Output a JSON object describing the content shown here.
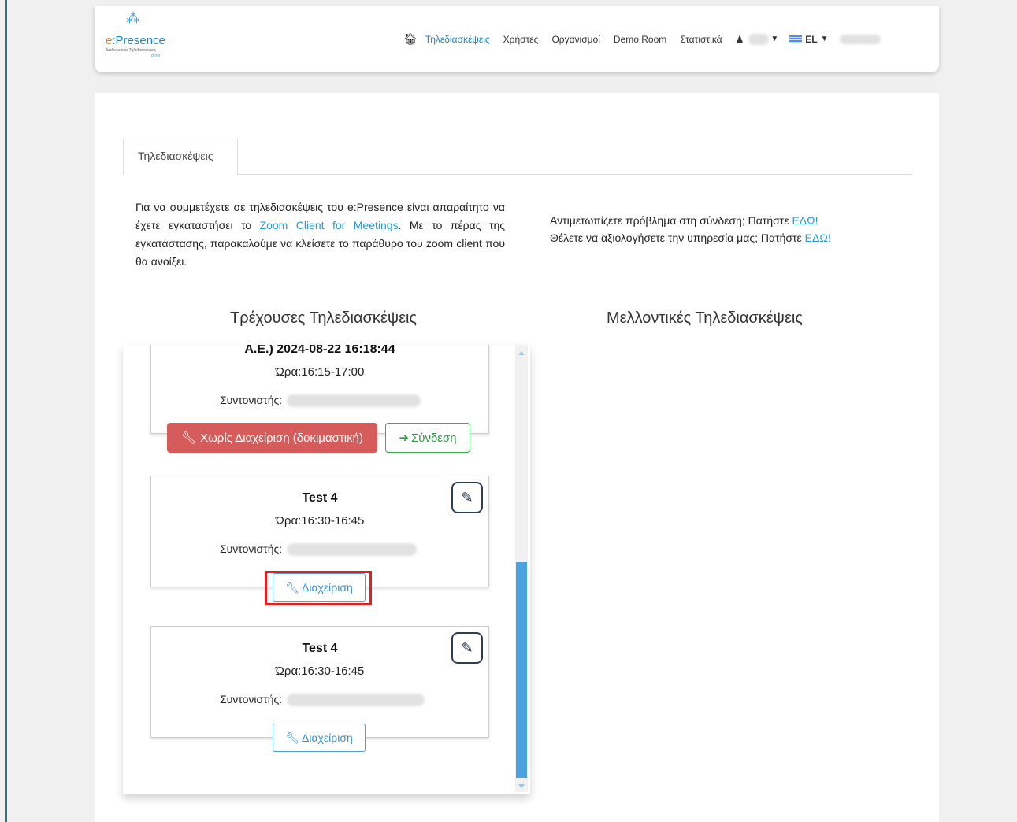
{
  "logo": {
    "dots": "⁂",
    "brand_e": "e",
    "brand_rest": ":Presence",
    "tagline": "Διαδικτυακές Τηλεδιασκέψεις",
    "tagline2": "grnet"
  },
  "nav": {
    "items": [
      {
        "label": "Τηλεδιασκέψεις",
        "active": true
      },
      {
        "label": "Χρήστες",
        "active": false
      },
      {
        "label": "Οργανισμοί",
        "active": false
      },
      {
        "label": "Demo Room",
        "active": false
      },
      {
        "label": "Στατιστικά",
        "active": false
      }
    ],
    "language": "EL"
  },
  "tab": {
    "label": "Τηλεδιασκέψεις"
  },
  "intro": {
    "text_before": "Για να συμμετέχετε σε τηλεδιασκέψεις του e:Presence είναι απαραίτητο να έχετε εγκαταστήσει το ",
    "link": "Zoom Client for Meetings",
    "text_after": ". Με το πέρας της εγκατάστασης, παρακαλούμε να κλείσετε το παράθυρο του zoom client που θα ανοίξει."
  },
  "help": {
    "line1": "Αντιμετωπίζετε πρόβλημα στη σύνδεση; Πατήστε ",
    "line1_link": "ΕΔΩ!",
    "line2": "Θέλετε να αξιολογήσετε την υπηρεσία μας; Πατήστε ",
    "line2_link": "ΕΔΩ!"
  },
  "columns": {
    "current": "Τρέχουσες Τηλεδιασκέψεις",
    "future": "Μελλοντικές Τηλεδιασκέψεις"
  },
  "meetings": [
    {
      "title": "Α.Ε.) 2024-08-22 16:18:44",
      "time": "Ώρα:16:15-17:00",
      "coordinator_label": "Συντονιστής:",
      "danger_btn": "Χωρίς Διαχείριση (δοκιμαστική)",
      "join_btn": "Σύνδεση"
    },
    {
      "title": "Test 4",
      "time": "Ώρα:16:30-16:45",
      "coordinator_label": "Συντονιστής:",
      "manage_btn": "Διαχείριση"
    },
    {
      "title": "Test 4",
      "time": "Ώρα:16:30-16:45",
      "coordinator_label": "Συντονιστής:",
      "manage_btn": "Διαχείριση"
    }
  ],
  "colors": {
    "accent": "#1c86c8",
    "danger": "#d65c5c",
    "success": "#3ab04a",
    "highlight": "#e02020"
  }
}
